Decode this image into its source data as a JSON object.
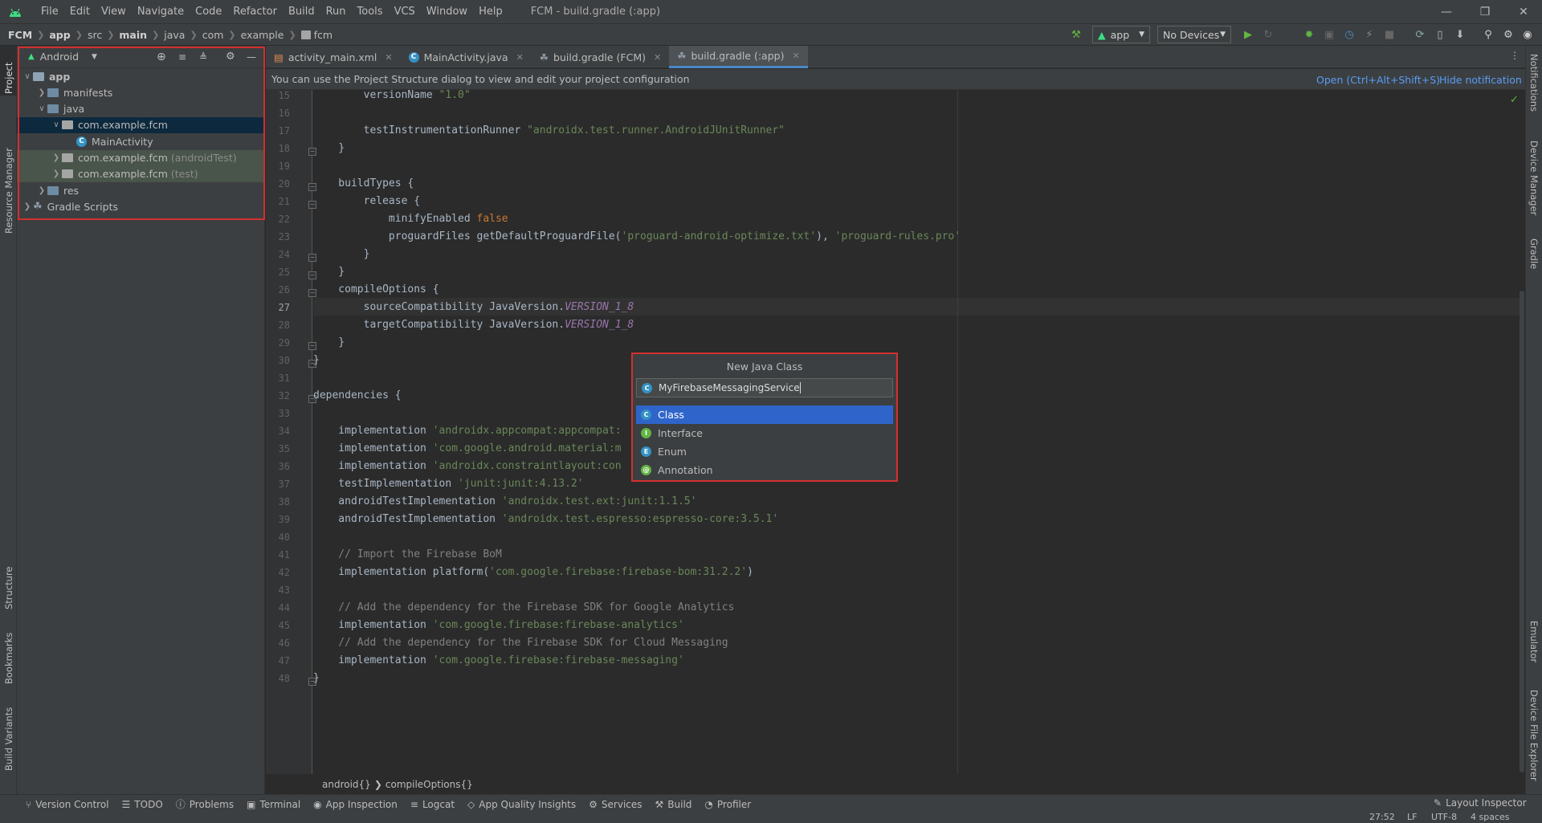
{
  "window": {
    "title": "FCM - build.gradle (:app)",
    "menu": [
      "File",
      "Edit",
      "View",
      "Navigate",
      "Code",
      "Refactor",
      "Build",
      "Run",
      "Tools",
      "VCS",
      "Window",
      "Help"
    ]
  },
  "navbar": {
    "breadcrumbs": [
      "FCM",
      "app",
      "src",
      "main",
      "java",
      "com",
      "example",
      "fcm"
    ],
    "run_config": "app",
    "device": "No Devices"
  },
  "left_strip": [
    "Project",
    "Resource Manager",
    "Structure",
    "Bookmarks",
    "Build Variants"
  ],
  "right_strip": [
    "Notifications",
    "Device Manager",
    "Gradle",
    "Emulator",
    "Device File Explorer"
  ],
  "project_panel": {
    "view_mode": "Android",
    "tree": [
      {
        "label": "app",
        "suffix": "",
        "depth": 0,
        "expanded": true,
        "kind": "module",
        "bold": true
      },
      {
        "label": "manifests",
        "suffix": "",
        "depth": 1,
        "expanded": false,
        "kind": "folder"
      },
      {
        "label": "java",
        "suffix": "",
        "depth": 1,
        "expanded": true,
        "kind": "folder"
      },
      {
        "label": "com.example.fcm",
        "suffix": "",
        "depth": 2,
        "expanded": true,
        "kind": "package",
        "selected": true
      },
      {
        "label": "MainActivity",
        "suffix": "",
        "depth": 3,
        "kind": "class"
      },
      {
        "label": "com.example.fcm",
        "suffix": "(androidTest)",
        "depth": 2,
        "expanded": false,
        "kind": "package",
        "test": true
      },
      {
        "label": "com.example.fcm",
        "suffix": "(test)",
        "depth": 2,
        "expanded": false,
        "kind": "package",
        "test": true
      },
      {
        "label": "res",
        "suffix": "",
        "depth": 1,
        "expanded": false,
        "kind": "folder"
      },
      {
        "label": "Gradle Scripts",
        "suffix": "",
        "depth": 0,
        "expanded": false,
        "kind": "gradle"
      }
    ]
  },
  "tabs": [
    {
      "label": "activity_main.xml",
      "icon": "xml-file-icon",
      "active": false
    },
    {
      "label": "MainActivity.java",
      "icon": "class-icon",
      "active": false
    },
    {
      "label": "build.gradle (FCM)",
      "icon": "gradle-icon",
      "active": false
    },
    {
      "label": "build.gradle (:app)",
      "icon": "gradle-icon",
      "active": true
    }
  ],
  "notification": {
    "text": "You can use the Project Structure dialog to view and edit your project configuration",
    "open_link": "Open (Ctrl+Alt+Shift+S)",
    "hide_link": "Hide notification"
  },
  "editor": {
    "current_line": "27",
    "lines": [
      {
        "n": "15",
        "tokens": [
          [
            "",
            "        versionName "
          ],
          [
            "str",
            "\"1.0\""
          ]
        ]
      },
      {
        "n": "16",
        "tokens": [
          [
            "",
            ""
          ]
        ]
      },
      {
        "n": "17",
        "tokens": [
          [
            "",
            "        testInstrumentationRunner "
          ],
          [
            "str",
            "\"androidx.test.runner.AndroidJUnitRunner\""
          ]
        ]
      },
      {
        "n": "18",
        "tokens": [
          [
            "",
            "    }"
          ]
        ]
      },
      {
        "n": "19",
        "tokens": [
          [
            "",
            ""
          ]
        ]
      },
      {
        "n": "20",
        "tokens": [
          [
            "",
            "    buildTypes {"
          ]
        ]
      },
      {
        "n": "21",
        "tokens": [
          [
            "",
            "        release {"
          ]
        ]
      },
      {
        "n": "22",
        "tokens": [
          [
            "",
            "            minifyEnabled "
          ],
          [
            "kw",
            "false"
          ]
        ]
      },
      {
        "n": "23",
        "tokens": [
          [
            "",
            "            proguardFiles getDefaultProguardFile("
          ],
          [
            "str",
            "'proguard-android-optimize.txt'"
          ],
          [
            "",
            "), "
          ],
          [
            "str",
            "'proguard-rules.pro'"
          ]
        ]
      },
      {
        "n": "24",
        "tokens": [
          [
            "",
            "        }"
          ]
        ]
      },
      {
        "n": "25",
        "tokens": [
          [
            "",
            "    }"
          ]
        ]
      },
      {
        "n": "26",
        "tokens": [
          [
            "",
            "    compileOptions {"
          ]
        ]
      },
      {
        "n": "27",
        "tokens": [
          [
            "",
            "        sourceCompatibility JavaVersion."
          ],
          [
            "it",
            "VERSION_1_8"
          ]
        ]
      },
      {
        "n": "28",
        "tokens": [
          [
            "",
            "        targetCompatibility JavaVersion."
          ],
          [
            "it",
            "VERSION_1_8"
          ]
        ]
      },
      {
        "n": "29",
        "tokens": [
          [
            "",
            "    }"
          ]
        ]
      },
      {
        "n": "30",
        "tokens": [
          [
            "",
            "}"
          ]
        ]
      },
      {
        "n": "31",
        "tokens": [
          [
            "",
            ""
          ]
        ]
      },
      {
        "n": "32",
        "tokens": [
          [
            "",
            "dependencies {"
          ]
        ]
      },
      {
        "n": "33",
        "tokens": [
          [
            "",
            ""
          ]
        ]
      },
      {
        "n": "34",
        "tokens": [
          [
            "",
            "    implementation "
          ],
          [
            "str",
            "'androidx.appcompat:appcompat:"
          ]
        ]
      },
      {
        "n": "35",
        "tokens": [
          [
            "",
            "    implementation "
          ],
          [
            "str",
            "'com.google.android.material:m"
          ]
        ]
      },
      {
        "n": "36",
        "tokens": [
          [
            "",
            "    implementation "
          ],
          [
            "str",
            "'androidx.constraintlayout:con"
          ]
        ]
      },
      {
        "n": "37",
        "tokens": [
          [
            "",
            "    testImplementation "
          ],
          [
            "str",
            "'junit:junit:4.13.2'"
          ]
        ]
      },
      {
        "n": "38",
        "tokens": [
          [
            "",
            "    androidTestImplementation "
          ],
          [
            "str",
            "'androidx.test.ext:junit:1.1.5'"
          ]
        ]
      },
      {
        "n": "39",
        "tokens": [
          [
            "",
            "    androidTestImplementation "
          ],
          [
            "str",
            "'androidx.test.espresso:espresso-core:3.5.1'"
          ]
        ]
      },
      {
        "n": "40",
        "tokens": [
          [
            "",
            ""
          ]
        ]
      },
      {
        "n": "41",
        "tokens": [
          [
            "cm",
            "    // Import the Firebase BoM"
          ]
        ]
      },
      {
        "n": "42",
        "tokens": [
          [
            "",
            "    implementation platform("
          ],
          [
            "str",
            "'com.google.firebase:firebase-bom:31.2.2'"
          ],
          [
            "",
            ")"
          ]
        ]
      },
      {
        "n": "43",
        "tokens": [
          [
            "",
            ""
          ]
        ]
      },
      {
        "n": "44",
        "tokens": [
          [
            "cm",
            "    // Add the dependency for the Firebase SDK for Google Analytics"
          ]
        ]
      },
      {
        "n": "45",
        "tokens": [
          [
            "",
            "    implementation "
          ],
          [
            "str",
            "'com.google.firebase:firebase-analytics'"
          ]
        ]
      },
      {
        "n": "46",
        "tokens": [
          [
            "cm",
            "    // Add the dependency for the Firebase SDK for Cloud Messaging"
          ]
        ]
      },
      {
        "n": "47",
        "tokens": [
          [
            "",
            "    implementation "
          ],
          [
            "str",
            "'com.google.firebase:firebase-messaging'"
          ]
        ]
      },
      {
        "n": "48",
        "tokens": [
          [
            "",
            "}"
          ]
        ]
      }
    ],
    "breadcrumb": [
      "android{}",
      "compileOptions{}"
    ]
  },
  "new_class_popup": {
    "title": "New Java Class",
    "input_value": "MyFirebaseMessagingService",
    "options": [
      {
        "label": "Class",
        "letter": "C",
        "color": "#3592c4",
        "selected": true
      },
      {
        "label": "Interface",
        "letter": "I",
        "color": "#62b543",
        "selected": false
      },
      {
        "label": "Enum",
        "letter": "E",
        "color": "#3592c4",
        "selected": false
      },
      {
        "label": "Annotation",
        "letter": "@",
        "color": "#62b543",
        "selected": false
      }
    ]
  },
  "statusbar": {
    "items": [
      "Version Control",
      "TODO",
      "Problems",
      "Terminal",
      "App Inspection",
      "Logcat",
      "App Quality Insights",
      "Services",
      "Build",
      "Profiler"
    ],
    "right": "Layout Inspector",
    "position": "27:52",
    "line_sep": "LF",
    "encoding": "UTF-8",
    "indent": "4 spaces"
  }
}
